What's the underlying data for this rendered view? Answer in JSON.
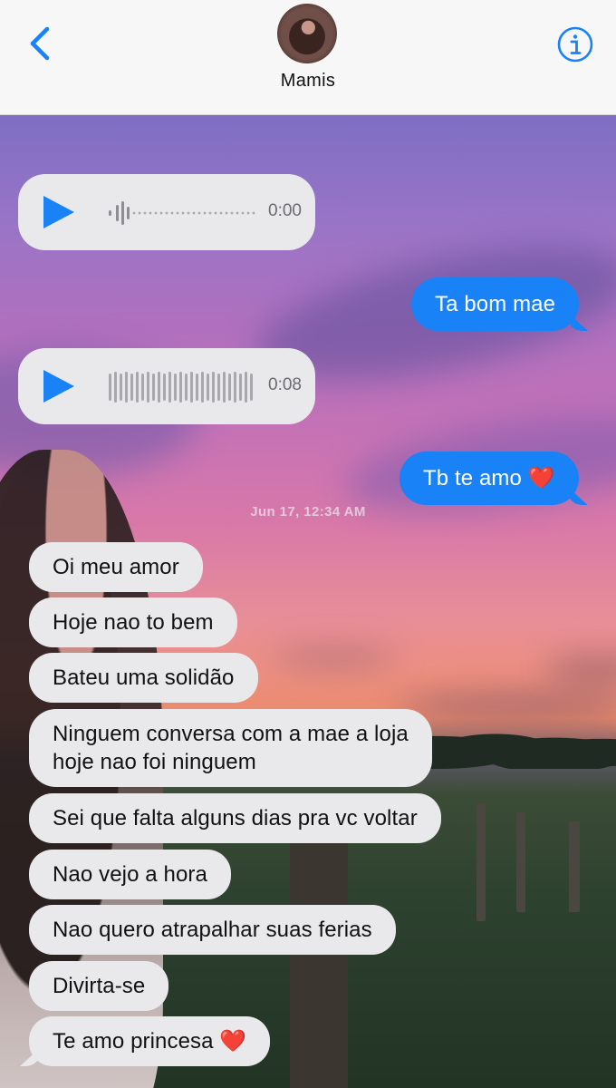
{
  "header": {
    "contact_name": "Mamis",
    "back_icon": "chevron-left-icon",
    "info_icon": "info-icon",
    "accent": "#1a82f7"
  },
  "conversation": {
    "timestamp": "Jun 17, 12:34 AM",
    "voice_messages": [
      {
        "duration": "0:00",
        "played": false
      },
      {
        "duration": "0:08",
        "played": true
      }
    ],
    "outgoing": [
      {
        "text": "Ta bom mae"
      },
      {
        "text": "Tb te amo",
        "emoji": "❤️"
      }
    ],
    "incoming": [
      {
        "text": "Oi meu amor"
      },
      {
        "text": "Hoje nao to bem"
      },
      {
        "text": "Bateu uma solidão"
      },
      {
        "line1": "Ninguem conversa com a mae a loja",
        "line2": "hoje nao foi ninguem"
      },
      {
        "text": "Sei que falta alguns dias pra vc voltar"
      },
      {
        "text": "Nao vejo a hora"
      },
      {
        "text": "Nao quero atrapalhar suas ferias"
      },
      {
        "text": "Divirta-se"
      },
      {
        "text": "Te amo princesa",
        "emoji": "❤️"
      }
    ]
  },
  "colors": {
    "outgoing_bubble": "#1a82f7",
    "incoming_bubble": "#e9e9eb",
    "header_bg": "#f7f7f8"
  }
}
